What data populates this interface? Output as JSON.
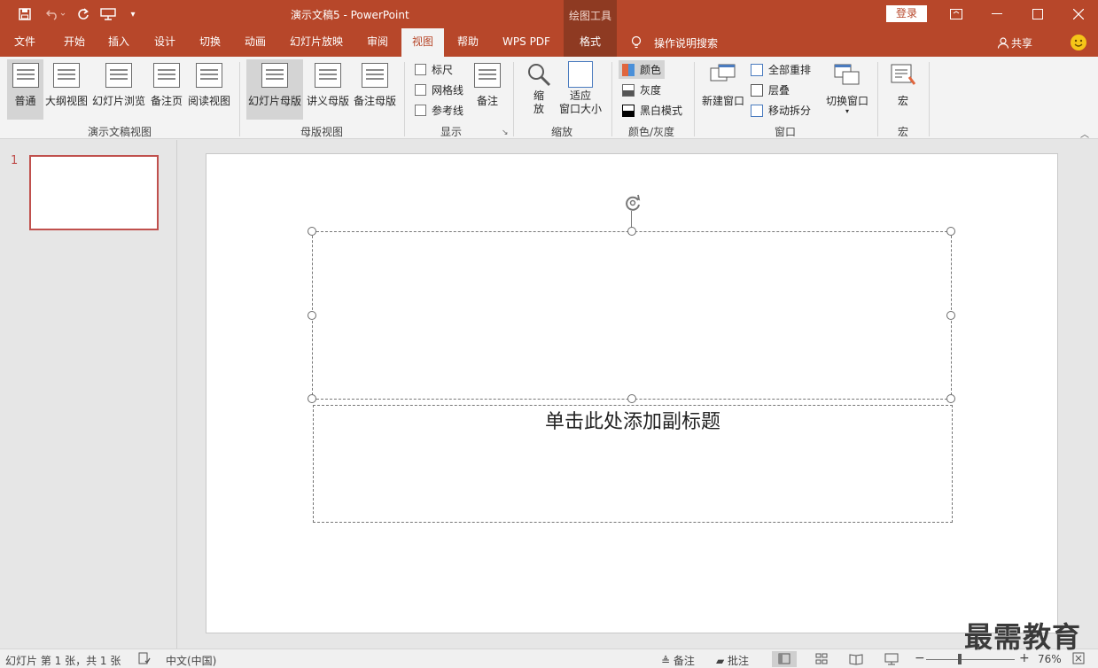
{
  "titlebar": {
    "title": "演示文稿5  -  PowerPoint",
    "context_group": "绘图工具",
    "login": "登录"
  },
  "tabs": [
    "文件",
    "开始",
    "插入",
    "设计",
    "切换",
    "动画",
    "幻灯片放映",
    "审阅",
    "视图",
    "帮助",
    "WPS PDF",
    "格式"
  ],
  "active_tab": "视图",
  "search_label": "操作说明搜索",
  "share_label": "共享",
  "ribbon": {
    "presentation_views": {
      "label": "演示文稿视图",
      "buttons": [
        "普通",
        "大纲视图",
        "幻灯片浏览",
        "备注页",
        "阅读视图"
      ]
    },
    "master_views": {
      "label": "母版视图",
      "buttons": [
        "幻灯片母版",
        "讲义母版",
        "备注母版"
      ]
    },
    "show": {
      "label": "显示",
      "checks": [
        "标尺",
        "网格线",
        "参考线"
      ],
      "notes": "备注"
    },
    "zoom": {
      "label": "缩放",
      "zoom_line1": "缩",
      "zoom_line2": "放",
      "fit_line1": "适应",
      "fit_line2": "窗口大小"
    },
    "color": {
      "label": "颜色/灰度",
      "items": [
        "颜色",
        "灰度",
        "黑白模式"
      ]
    },
    "window": {
      "label": "窗口",
      "new_window": "新建窗口",
      "arrange_all": "全部重排",
      "cascade": "层叠",
      "move_split": "移动拆分",
      "switch_window": "切换窗口"
    },
    "macros": {
      "label": "宏",
      "button": "宏"
    }
  },
  "thumbnail": {
    "number": "1"
  },
  "slide": {
    "subtitle_placeholder": "单击此处添加副标题"
  },
  "statusbar": {
    "slide_info": "幻灯片 第 1 张，共 1 张",
    "language": "中文(中国)",
    "notes": "备注",
    "comments": "批注",
    "zoom_minus": "−",
    "zoom_plus": "+",
    "zoom_level": "76%"
  },
  "watermark": "最需教育",
  "colors": {
    "accent": "#b7472a",
    "context": "#8e3a22",
    "thumb_border": "#c0504d"
  }
}
